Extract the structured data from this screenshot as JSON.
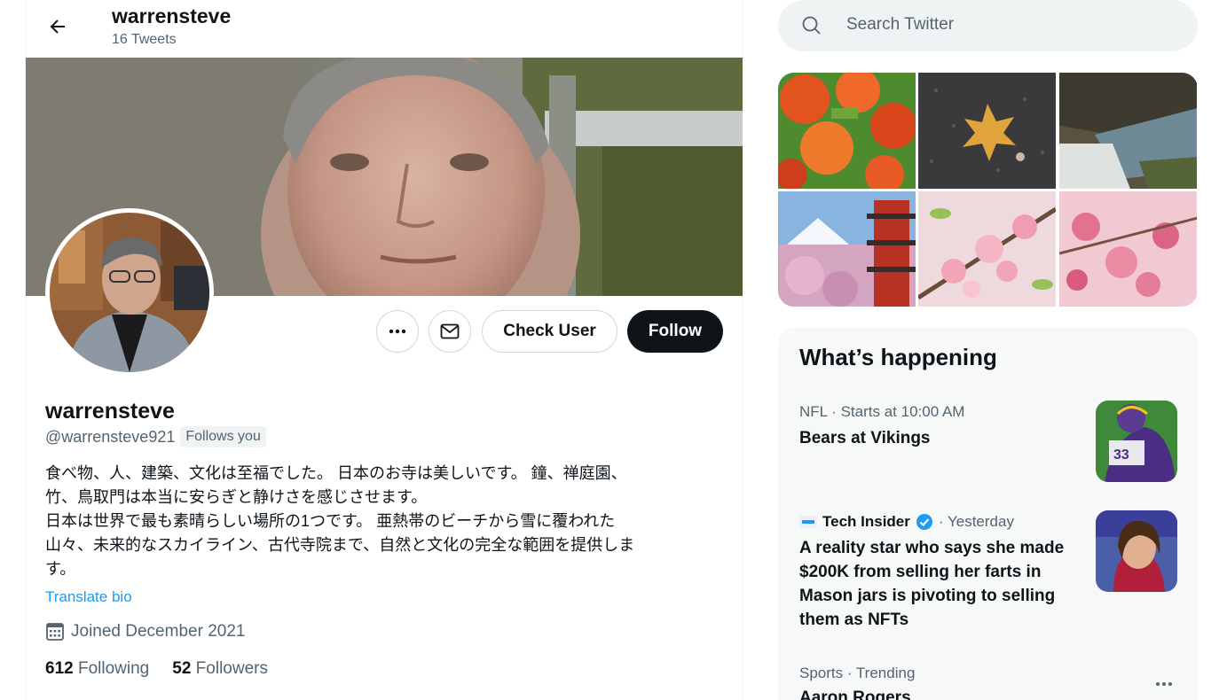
{
  "header": {
    "name": "warrensteve",
    "tweet_count": "16 Tweets"
  },
  "profile": {
    "name": "warrensteve",
    "handle": "@warrensteve921",
    "follows_you": "Follows you",
    "bio_lines": [
      "食べ物、人、建築、文化は至福でした。 日本のお寺は美しいです。 鐘、禅庭園、",
      "竹、鳥取門は本当に安らぎと静けさを感じさせます。",
      "日本は世界で最も素晴らしい場所の1つです。 亜熱帯のビーチから雪に覆われた",
      "山々、未来的なスカイライン、古代寺院まで、自然と文化の完全な範囲を提供しま",
      "す。"
    ],
    "translate_bio": "Translate bio",
    "joined": "Joined December 2021",
    "following_count": "612",
    "following_label": "Following",
    "followers_count": "52",
    "followers_label": "Followers"
  },
  "actions": {
    "check_user": "Check User",
    "follow": "Follow",
    "more_icon": "more-horizontal-icon",
    "message_icon": "envelope-icon"
  },
  "search": {
    "placeholder": "Search Twitter"
  },
  "whats_happening": {
    "title": "What’s happening",
    "trends": [
      {
        "meta": "NFL · Starts at 10:00 AM",
        "title": "Bears at Vikings"
      },
      {
        "source": "Tech Insider",
        "meta": "· Yesterday",
        "title_lines": [
          "A reality star who says she made",
          "$200K from selling her farts in",
          "Mason jars is pivoting to selling",
          "them as NFTs"
        ]
      },
      {
        "meta": "Sports · Trending",
        "title": "Aaron Rogers"
      }
    ]
  },
  "colors": {
    "accent": "#1d9bf0",
    "text": "#0f1419",
    "secondary": "#536471",
    "panel": "#f7f9f9",
    "follow_button": "#0f1419"
  }
}
